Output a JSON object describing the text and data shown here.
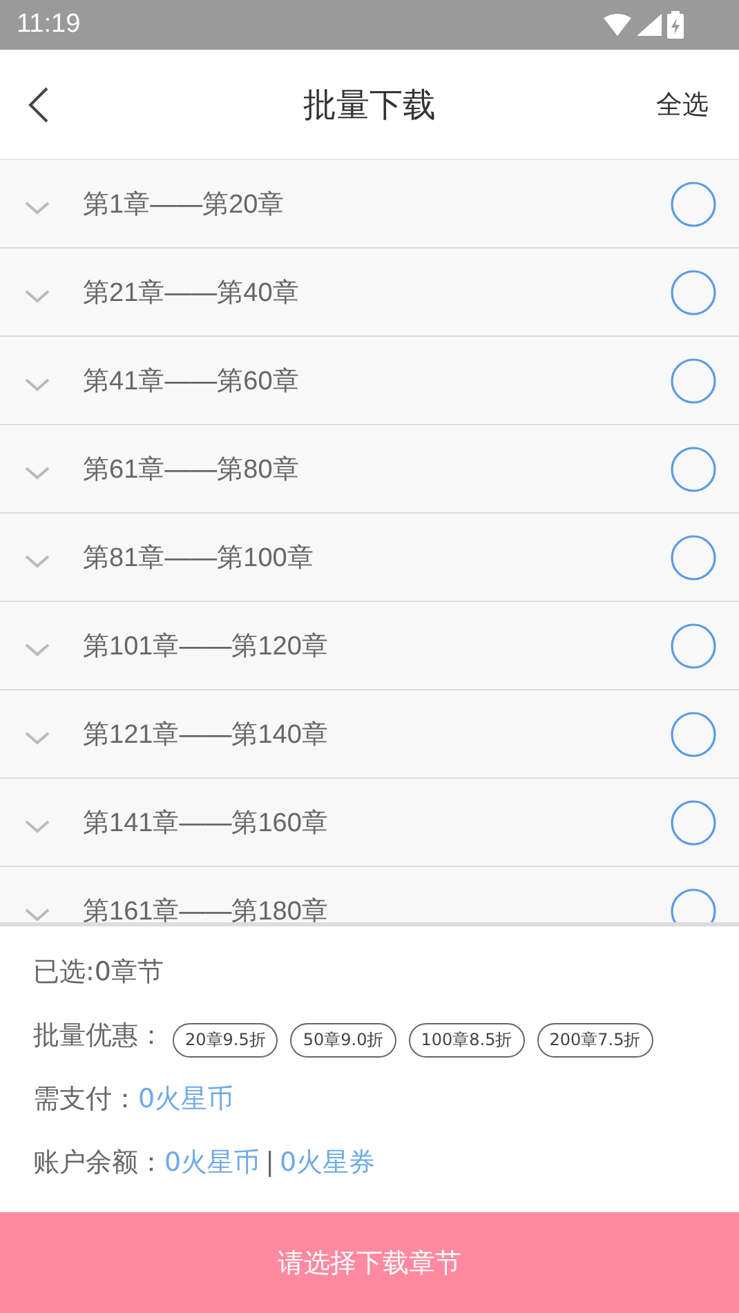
{
  "status_bar": {
    "time": "11:19"
  },
  "header": {
    "title": "批量下载",
    "action": "全选"
  },
  "chapters": [
    {
      "label": "第1章——第20章",
      "checked": false
    },
    {
      "label": "第21章——第40章",
      "checked": false
    },
    {
      "label": "第41章——第60章",
      "checked": false
    },
    {
      "label": "第61章——第80章",
      "checked": false
    },
    {
      "label": "第81章——第100章",
      "checked": false
    },
    {
      "label": "第101章——第120章",
      "checked": false
    },
    {
      "label": "第121章——第140章",
      "checked": false
    },
    {
      "label": "第141章——第160章",
      "checked": false
    },
    {
      "label": "第161章——第180章",
      "checked": false
    }
  ],
  "summary": {
    "selected": "已选:0章节",
    "discount_label": "批量优惠：",
    "discounts": [
      "20章9.5折",
      "50章9.0折",
      "100章8.5折",
      "200章7.5折"
    ],
    "pay_label": "需支付：",
    "pay_value": "0火星币",
    "balance_label": "账户余额：",
    "balance_coins": "0火星币",
    "balance_separator": "|",
    "balance_vouchers": "0火星券"
  },
  "download_button": {
    "label": "请选择下载章节",
    "disabled": true
  }
}
